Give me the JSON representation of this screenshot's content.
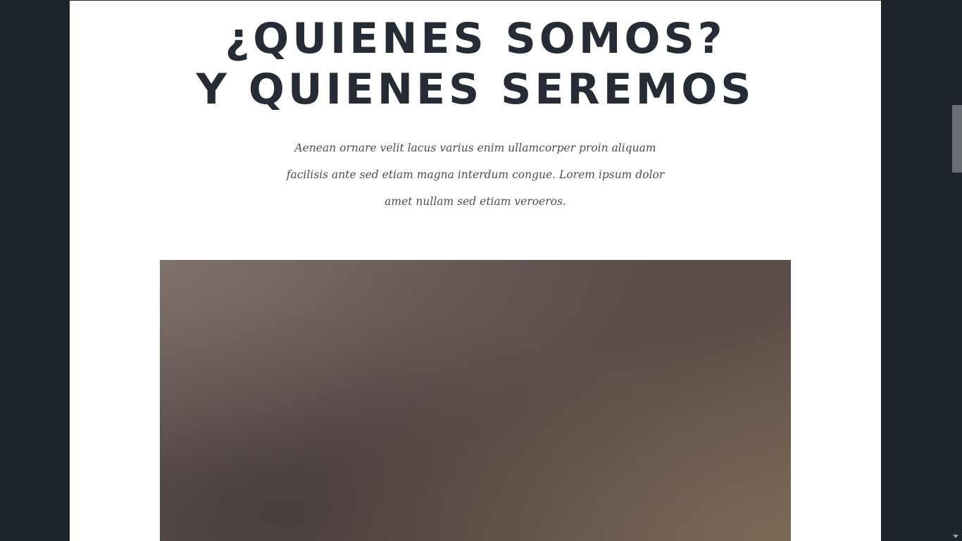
{
  "section": {
    "heading_line1": "¿QUIENES SOMOS?",
    "heading_line2": "Y QUIENES SEREMOS",
    "lead_line1": "Aenean ornare velit lacus varius enim ullamcorper proin aliquam",
    "lead_line2": "facilisis ante sed etiam magna interdum congue. Lorem ipsum dolor",
    "lead_line3": "amet nullam sed etiam veroeros."
  },
  "colors": {
    "background": "#1d242d",
    "panel": "#ffffff",
    "heading": "#252c35",
    "body_text": "#4a4e55"
  }
}
